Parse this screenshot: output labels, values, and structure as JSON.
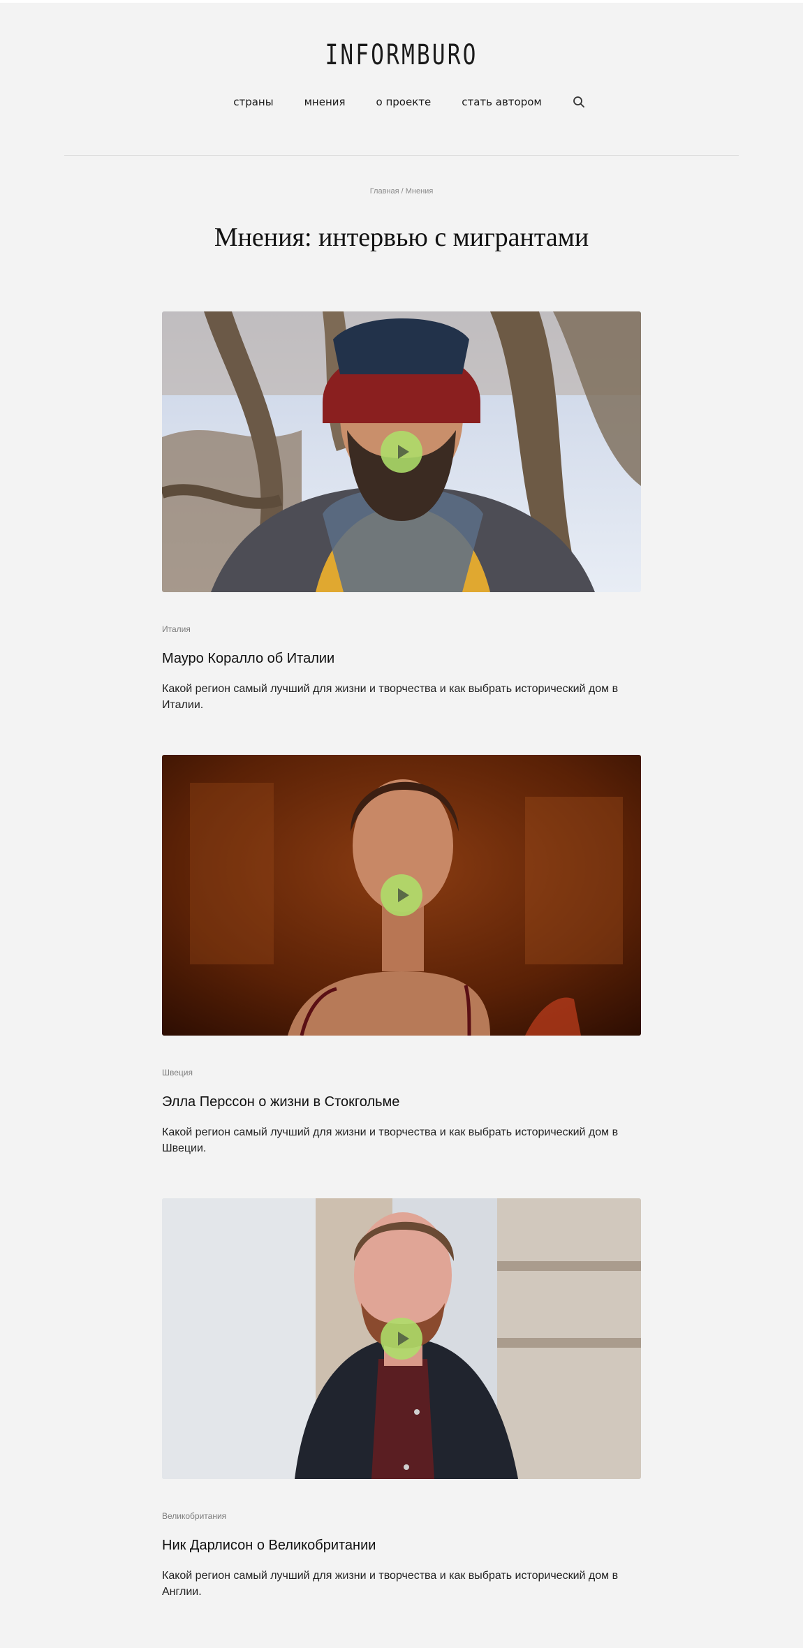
{
  "header": {
    "logo": "INFORMBURO",
    "nav": [
      "страны",
      "мнения",
      "о проекте",
      "стать автором"
    ],
    "search_icon": "search-icon"
  },
  "breadcrumb": {
    "home": "Главная",
    "separator": " / ",
    "current": "Мнения"
  },
  "page_title": "Мнения: интервью с мигрантами",
  "colors": {
    "background": "#f3f3f3",
    "play_button": "#addE6a",
    "divider": "#dcdcdc"
  },
  "cards": [
    {
      "country": "Италия",
      "title": "Мауро Коралло об Италии",
      "description": "Какой регион самый лучший для жизни и творчества и как выбрать исторический дом в Италии.",
      "play_icon": "play-icon"
    },
    {
      "country": "Швеция",
      "title": "Элла Перссон о жизни в Стокгольме",
      "description": "Какой регион самый лучший для жизни и творчества и как выбрать исторический дом в Швеции.",
      "play_icon": "play-icon"
    },
    {
      "country": "Великобритания",
      "title": "Ник Дарлисон о Великобритании",
      "description": "Какой регион самый лучший для жизни и творчества и как выбрать исторический дом в Англии.",
      "play_icon": "play-icon"
    }
  ]
}
